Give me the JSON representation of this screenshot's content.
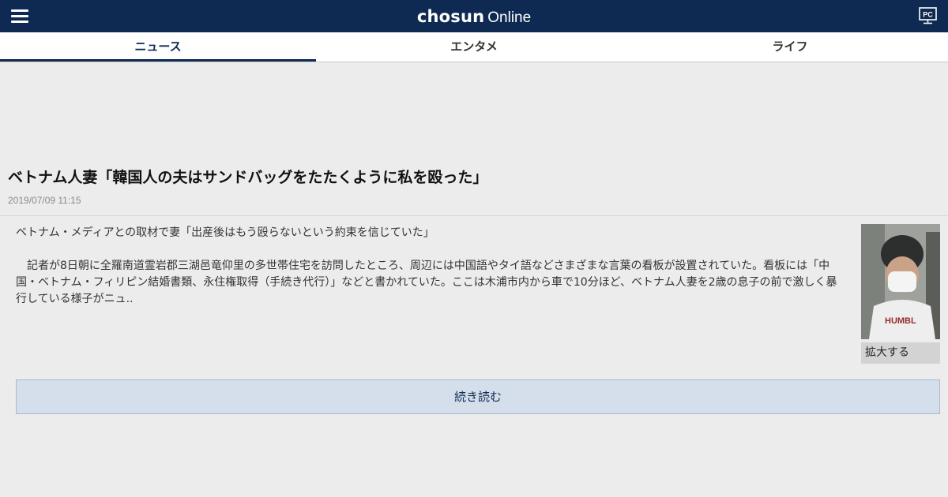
{
  "header": {
    "brand": "chosun",
    "brand_suffix": "Online",
    "pc_label": "PC",
    "menu_icon": "hamburger-icon",
    "pc_icon": "monitor-icon",
    "bar_color": "#0f2a52"
  },
  "tabs": [
    {
      "label": "ニュース",
      "active": true
    },
    {
      "label": "エンタメ",
      "active": false
    },
    {
      "label": "ライフ",
      "active": false
    }
  ],
  "article": {
    "title": "ベトナム人妻「韓国人の夫はサンドバッグをたたくように私を殴った」",
    "date": "2019/07/09 11:15",
    "lead": "ベトナム・メディアとの取材で妻「出産後はもう殴らないという約束を信じていた」",
    "body": "記者が8日朝に全羅南道霊岩郡三湖邑竜仰里の多世帯住宅を訪問したところ、周辺には中国語やタイ語などさまざまな言葉の看板が設置されていた。看板には「中国・ベトナム・フィリピン結婚書類、永住権取得（手続き代行）」などと書かれていた。ここは木浦市内から車で10分ほど、ベトナム人妻を2歳の息子の前で激しく暴行している様子がニュ..",
    "photo_text": "HUMBL",
    "enlarge_label": "拡大する",
    "read_more_label": "続き読む"
  }
}
